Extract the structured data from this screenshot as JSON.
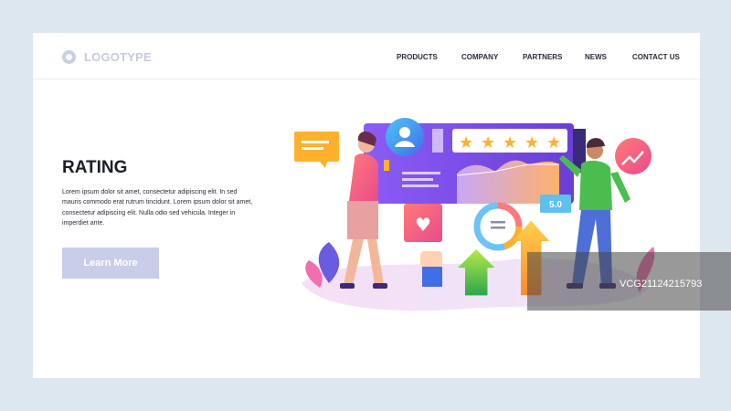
{
  "header": {
    "logo_text": "LOGOTYPE",
    "nav": [
      "PRODUCTS",
      "COMPANY",
      "PARTNERS",
      "NEWS",
      "CONTACT US"
    ]
  },
  "hero": {
    "title": "RATING",
    "body": "Lorem ipsum dolor sit amet, consectetur adipiscing elit. In sed mauris commodo erat rutrum tincidunt. Lorem ipsum dolor sit amet, consectetur adipiscing elit. Nulla odio sed vehicula. Integer in imperdiet ante.",
    "cta_label": "Learn More"
  },
  "illustration": {
    "score": "5.0",
    "stars": 5
  },
  "watermark": {
    "text": "VCG21124215793"
  },
  "colors": {
    "background": "#dde7ef",
    "card": "#ffffff",
    "button": "#c8cde9",
    "accent_purple": "#7a55e0",
    "accent_pink": "#f25b86",
    "accent_green": "#4bbd4f",
    "accent_orange": "#ffb12e"
  }
}
